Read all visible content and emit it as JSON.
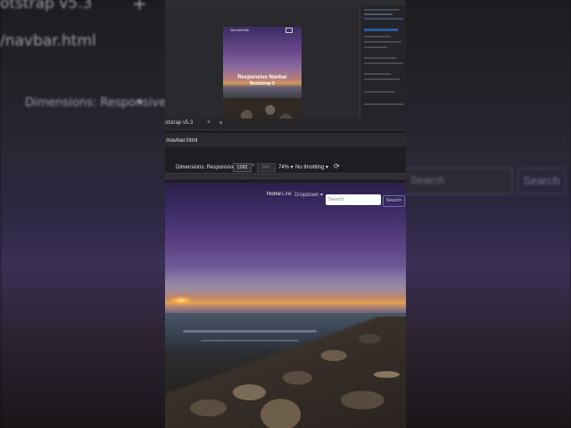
{
  "background": {
    "tab_label": "otstrap v5.3",
    "url": "/navbar.html",
    "dimensions": "Dimensions: Responsive",
    "dimensions_caret": "▾",
    "search_placeholder": "Search",
    "search_button": "Search"
  },
  "devtools_preview": {
    "brand": "JsCodeHub",
    "hero_title": "Responsive Navbar",
    "hero_subtitle": "Bootstrap 5"
  },
  "browser": {
    "tab_label": "otstrap v5.3",
    "url": "/navbar.html"
  },
  "device_toolbar": {
    "dimensions": "Dimensions: Responsive ▾",
    "width": "1282",
    "times": "×",
    "height": "847",
    "zoom": "74% ▾",
    "throttle": "No throttling ▾",
    "rotate_icon": "rotate-icon"
  },
  "page": {
    "nav_home": "Home",
    "nav_link": "Link",
    "nav_dropdown": "Dropdown ▾",
    "search_placeholder": "Search",
    "search_button": "Search"
  },
  "colors": {
    "accent": "#6b6fa8",
    "sky": "#3d2d68"
  }
}
